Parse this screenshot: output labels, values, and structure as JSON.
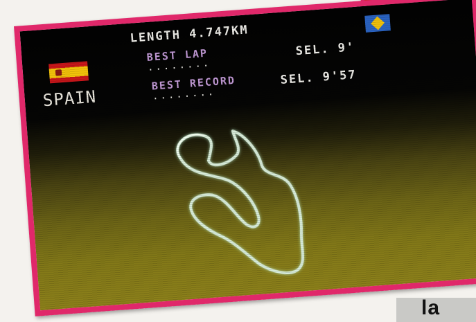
{
  "screen": {
    "length_label": "LENGTH 4.747KM",
    "best_lap_label": "BEST LAP",
    "best_lap_dots": "........",
    "best_lap_value": "SEL. 9'",
    "best_record_label": "BEST RECORD",
    "best_record_dots": "........",
    "best_record_value": "SEL. 9'57",
    "country_name": "SPAIN"
  },
  "caption": {
    "text": "la"
  },
  "colors": {
    "frame": "#e0286a",
    "label_purple": "#c29ad6",
    "track_line": "#d8ecd9",
    "screen_ground": "#827818"
  },
  "icons": {
    "country_flag": "spain-flag-icon",
    "rival_flag": "sweden-flag-icon"
  }
}
